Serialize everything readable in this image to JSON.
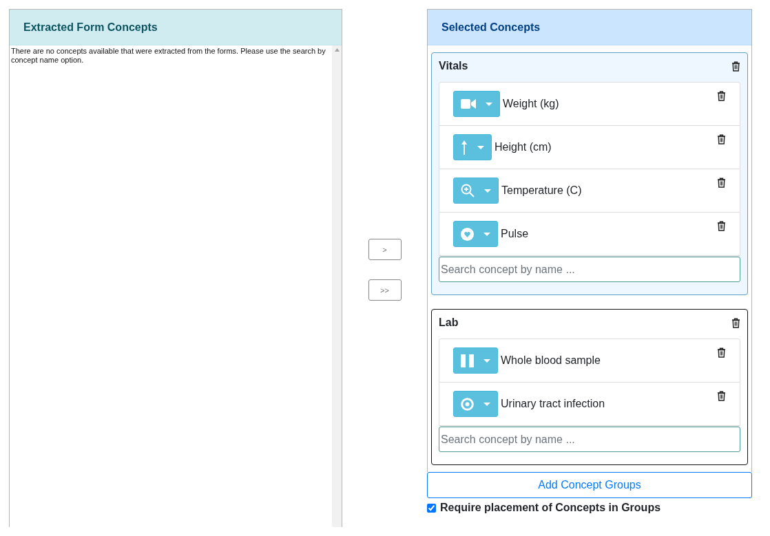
{
  "extracted_panel": {
    "title": "Extracted Form Concepts",
    "message": "There are no concepts available that were extracted from the forms. Please use the search by concept name option."
  },
  "transfer_buttons": [
    ">",
    ">>"
  ],
  "selected_panel": {
    "title": "Selected Concepts",
    "groups": [
      {
        "name": "Vitals",
        "selected": true,
        "search_placeholder": "Search concept by name ...",
        "concepts": [
          {
            "name": "Weight (kg)",
            "kind": "video"
          },
          {
            "name": "Height (cm)",
            "kind": "arrow"
          },
          {
            "name": "Temperature (C)",
            "kind": "zoom"
          },
          {
            "name": "Pulse",
            "kind": "heart"
          }
        ]
      },
      {
        "name": "Lab",
        "selected": false,
        "search_placeholder": "Search concept by name ...",
        "concepts": [
          {
            "name": "Whole blood sample",
            "kind": "pause"
          },
          {
            "name": "Urinary tract infection",
            "kind": "target"
          }
        ]
      }
    ],
    "add_button": "Add Concept Groups",
    "require_placement": {
      "label": "Require placement of Concepts in Groups",
      "checked": true
    }
  }
}
